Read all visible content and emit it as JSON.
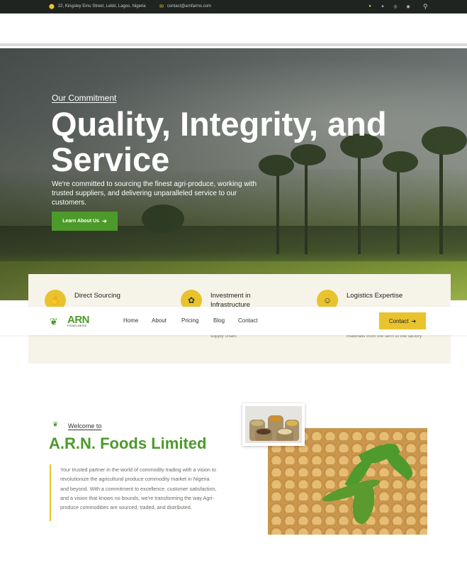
{
  "topbar": {
    "address": "22, Kingsley Emu Street, Lekki, Lagos, Nigeria",
    "email": "contact@arnfarms.com",
    "social": [
      "facebook-icon",
      "twitter-icon",
      "instagram-icon",
      "pinterest-icon"
    ],
    "search_icon": "search-icon"
  },
  "hero": {
    "eyebrow": "Our Commitment",
    "title": "Quality, Integrity, and Service",
    "description": "We're committed to sourcing the finest agri-produce, working with trusted suppliers, and delivering unparalleled service to our customers.",
    "button_label": "Learn About Us"
  },
  "features": [
    {
      "title": "Direct Sourcing",
      "description": "",
      "icon": "sourcing-icon"
    },
    {
      "title": "Investment in Infrastructure",
      "description": "supply chain.",
      "icon": "investment-icon"
    },
    {
      "title": "Logistics Expertise",
      "description": "materials from the farm to the factory",
      "icon": "logistics-icon"
    }
  ],
  "navbar": {
    "logo_name": "ARN",
    "logo_sub": "FOODS LIMITED",
    "items": [
      "Home",
      "About",
      "Pricing",
      "Blog",
      "Contact"
    ],
    "contact_button": "Contact"
  },
  "about": {
    "welcome": "Welcome to",
    "title": "A.R.N. Foods Limited",
    "text": "Your trusted partner in the world of commodity trading with a vision to revolutionize the agricultural produce commodity market in Nigeria and beyond. With a commitment to excellence, customer satisfaction, and a vision that knows no bounds, we're transforming the way Agri-produce commodities are sourced, traded, and distributed."
  },
  "colors": {
    "primary_green": "#4c9a2a",
    "accent_yellow": "#e8c32e",
    "topbar_bg": "#1f2420",
    "feature_bg": "#f6f3e8"
  }
}
